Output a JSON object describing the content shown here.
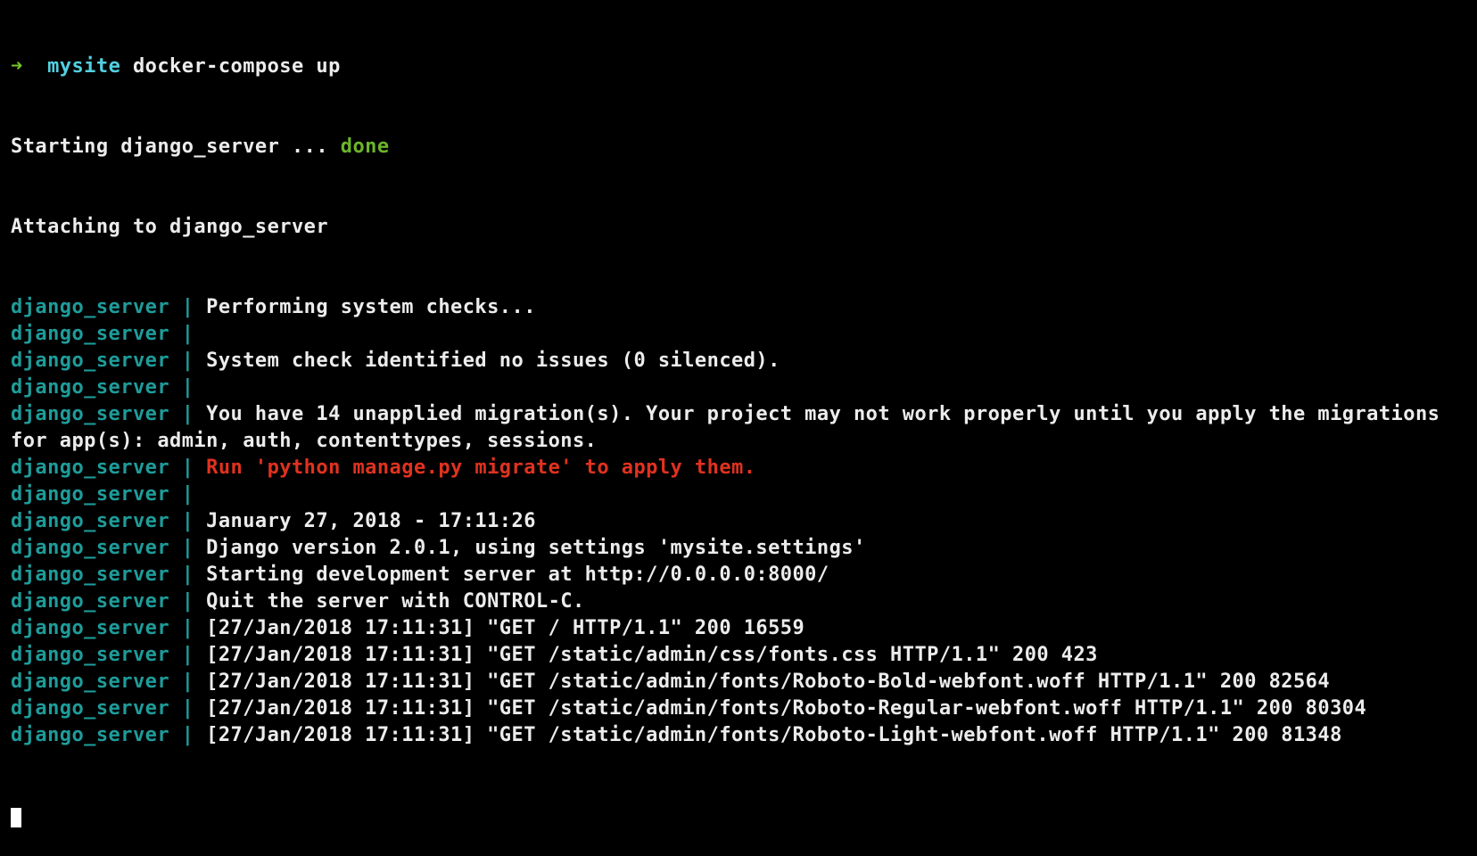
{
  "prompt": {
    "arrow": "➜",
    "directory": "mysite",
    "command": "docker-compose up"
  },
  "starting": {
    "text": "Starting django_server ... ",
    "status": "done"
  },
  "attaching": "Attaching to django_server",
  "container_prefix": "django_server",
  "separator": "|",
  "logs": [
    {
      "text": "Performing system checks...",
      "color": "white"
    },
    {
      "text": "",
      "color": "white"
    },
    {
      "text": "System check identified no issues (0 silenced).",
      "color": "white"
    },
    {
      "text": "",
      "color": "white"
    },
    {
      "text": "You have 14 unapplied migration(s). Your project may not work properly until you apply the migrations",
      "color": "white",
      "continuation": "for app(s): admin, auth, contenttypes, sessions."
    },
    {
      "text": "Run 'python manage.py migrate' to apply them.",
      "color": "red"
    },
    {
      "text": "",
      "color": "white"
    },
    {
      "text": "January 27, 2018 - 17:11:26",
      "color": "white"
    },
    {
      "text": "Django version 2.0.1, using settings 'mysite.settings'",
      "color": "white"
    },
    {
      "text": "Starting development server at http://0.0.0.0:8000/",
      "color": "white"
    },
    {
      "text": "Quit the server with CONTROL-C.",
      "color": "white"
    },
    {
      "text": "[27/Jan/2018 17:11:31] \"GET / HTTP/1.1\" 200 16559",
      "color": "white"
    },
    {
      "text": "[27/Jan/2018 17:11:31] \"GET /static/admin/css/fonts.css HTTP/1.1\" 200 423",
      "color": "white"
    },
    {
      "text": "[27/Jan/2018 17:11:31] \"GET /static/admin/fonts/Roboto-Bold-webfont.woff HTTP/1.1\" 200 82564",
      "color": "white"
    },
    {
      "text": "[27/Jan/2018 17:11:31] \"GET /static/admin/fonts/Roboto-Regular-webfont.woff HTTP/1.1\" 200 80304",
      "color": "white"
    },
    {
      "text": "[27/Jan/2018 17:11:31] \"GET /static/admin/fonts/Roboto-Light-webfont.woff HTTP/1.1\" 200 81348",
      "color": "white"
    }
  ],
  "colors": {
    "background": "#000000",
    "text": "#ececec",
    "prompt_arrow": "#74c72a",
    "prompt_dir": "#52d0e0",
    "done": "#6cb52a",
    "container": "#1e9c9a",
    "error": "#e0321f"
  }
}
